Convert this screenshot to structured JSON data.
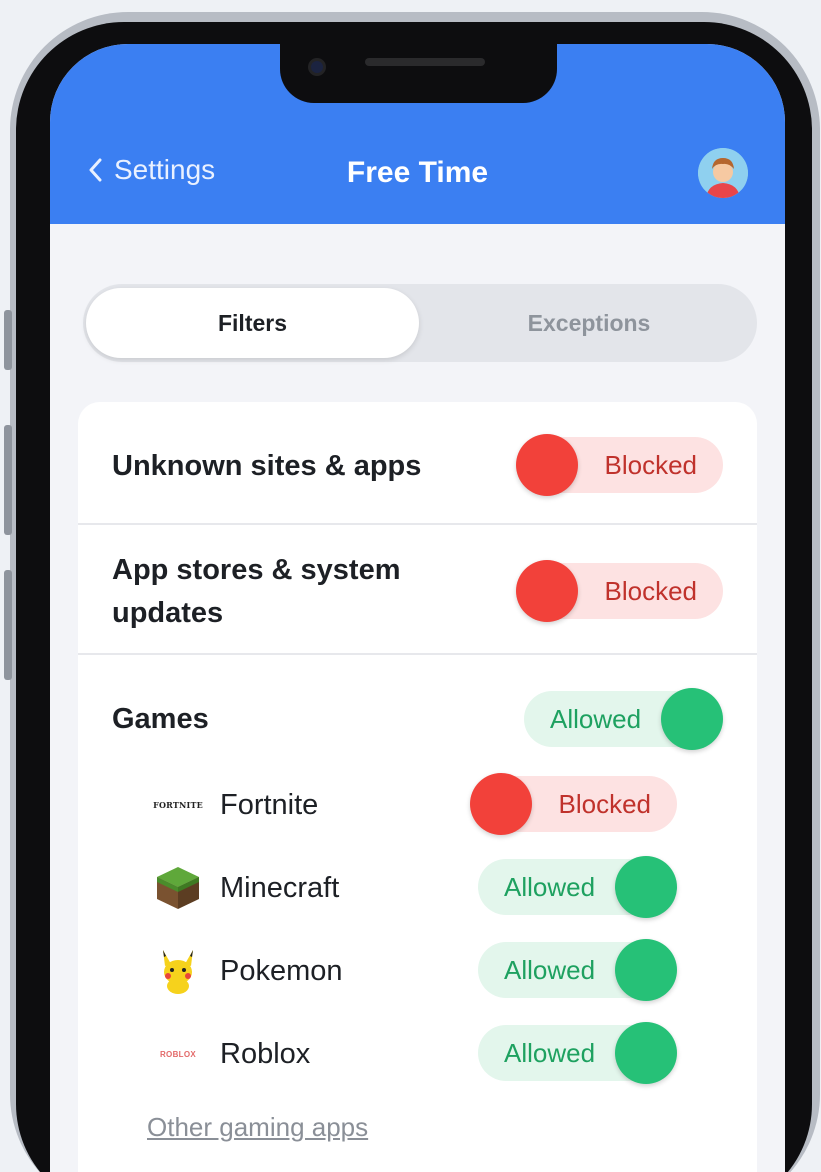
{
  "header": {
    "back_label": "Settings",
    "title": "Free Time",
    "color": "#3b7ff2"
  },
  "tabs": [
    {
      "label": "Filters",
      "active": true
    },
    {
      "label": "Exceptions",
      "active": false
    }
  ],
  "filters": [
    {
      "label": "Unknown sites & apps",
      "state": "Blocked"
    },
    {
      "label_line1": "App stores & system",
      "label_line2": "updates",
      "state": "Blocked"
    },
    {
      "label": "Games",
      "state": "Allowed"
    }
  ],
  "games": [
    {
      "name": "Fortnite",
      "state": "Blocked",
      "icon": "fortnite-logo-icon",
      "icon_text": "FORTNITE"
    },
    {
      "name": "Minecraft",
      "state": "Allowed",
      "icon": "minecraft-grass-block-icon"
    },
    {
      "name": "Pokemon",
      "state": "Allowed",
      "icon": "pikachu-icon"
    },
    {
      "name": "Roblox",
      "state": "Allowed",
      "icon": "roblox-logo-icon",
      "icon_text": "ROBLOX"
    }
  ],
  "other_link": "Other gaming apps",
  "colors": {
    "blocked_knob": "#f2413a",
    "blocked_bg": "#fde2e2",
    "allowed_knob": "#26c177",
    "allowed_bg": "#e3f6ec"
  }
}
